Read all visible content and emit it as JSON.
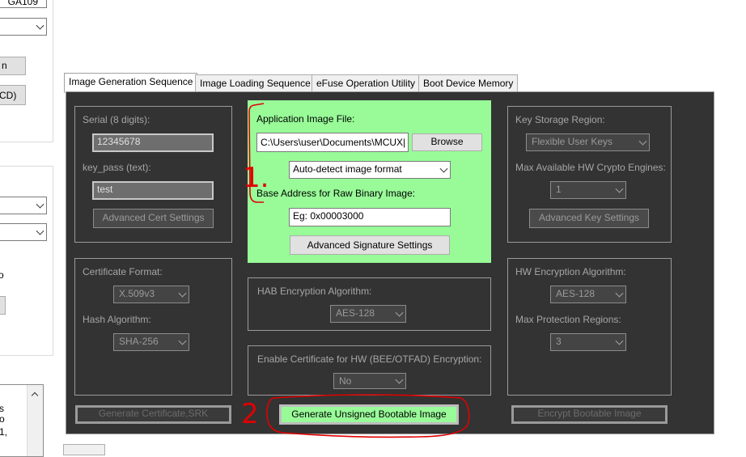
{
  "left_panel": {
    "combo_top_text": "GA109",
    "button_n": "n",
    "button_cd": "CD)",
    "scroll_lines": [
      "s",
      "o",
      "1,"
    ],
    "scroll_up_icon": "chevron-up-icon"
  },
  "tabs": [
    {
      "label": "Image Generation Sequence"
    },
    {
      "label": "Image Loading Sequence"
    },
    {
      "label": "eFuse Operation Utility"
    },
    {
      "label": "Boot Device Memory"
    }
  ],
  "left_group": {
    "serial_label": "Serial (8 digits):",
    "serial_value": "12345678",
    "keypass_label": "key_pass (text):",
    "keypass_value": "test",
    "adv_cert_btn": "Advanced Cert Settings"
  },
  "cert_group": {
    "format_label": "Certificate Format:",
    "format_value": "X.509v3",
    "hash_label": "Hash Algorithm:",
    "hash_value": "SHA-256"
  },
  "app_group": {
    "app_label": "Application Image File:",
    "app_path": "C:\\Users\\user\\Documents\\MCUX|",
    "browse_btn": "Browse",
    "format_value": "Auto-detect image format",
    "base_label": "Base Address for Raw Binary Image:",
    "base_placeholder": "Eg: 0x00003000",
    "adv_sig_btn": "Advanced Signature Settings",
    "background_color": "#98fb98"
  },
  "hab_group": {
    "label": "HAB Encryption Algorithm:",
    "value": "AES-128"
  },
  "enable_group": {
    "label": "Enable Certificate for HW (BEE/OTFAD) Encryption:",
    "value": "No"
  },
  "key_group": {
    "region_label": "Key Storage Region:",
    "region_value": "Flexible User Keys",
    "max_label": "Max Available HW Crypto Engines:",
    "max_value": "1",
    "adv_key_btn": "Advanced Key Settings"
  },
  "hw_group": {
    "algo_label": "HW Encryption Algorithm:",
    "algo_value": "AES-128",
    "regions_label": "Max Protection Regions:",
    "regions_value": "3"
  },
  "bottom_buttons": {
    "gen_cert": "Generate Certificate,SRK",
    "gen_unsigned": "Generate Unsigned Bootable Image",
    "encrypt": "Encrypt Bootable Image"
  },
  "annotations": {
    "one": "1.",
    "two": "2",
    "color": "#e00000"
  }
}
